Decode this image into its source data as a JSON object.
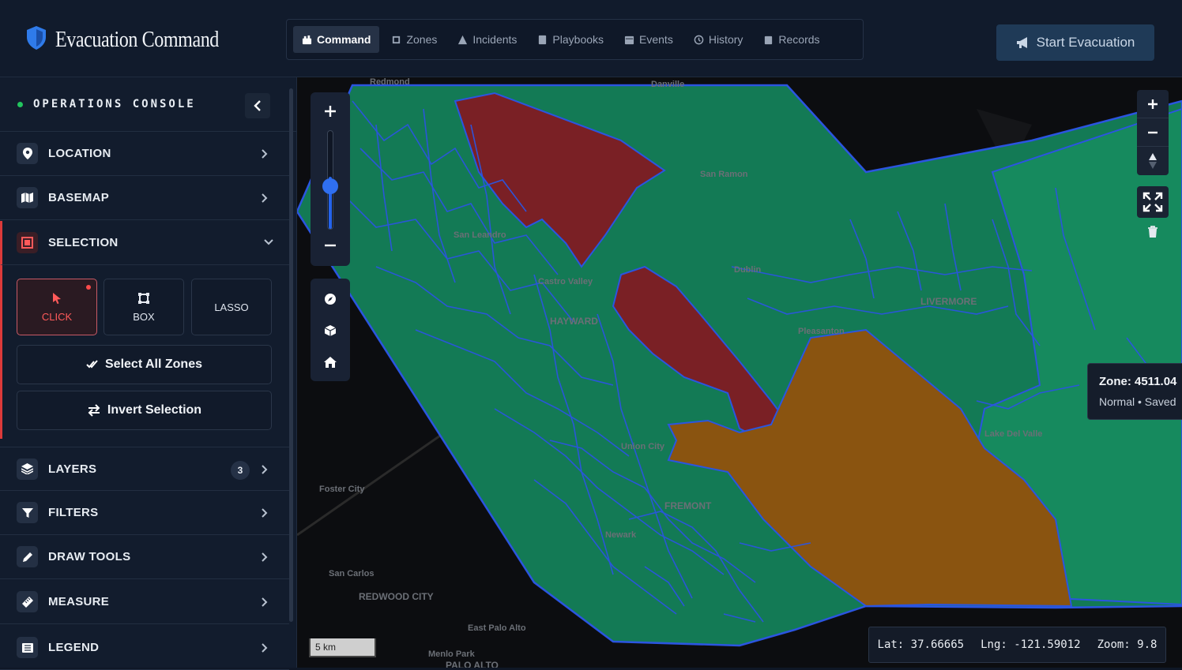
{
  "app": {
    "title": "Evacuation Command",
    "start_button": "Start Evacuation"
  },
  "nav": {
    "tabs": [
      {
        "label": "Command",
        "icon": "command-icon",
        "active": true
      },
      {
        "label": "Zones",
        "icon": "zones-icon",
        "active": false
      },
      {
        "label": "Incidents",
        "icon": "warning-icon",
        "active": false
      },
      {
        "label": "Playbooks",
        "icon": "book-icon",
        "active": false
      },
      {
        "label": "Events",
        "icon": "calendar-icon",
        "active": false
      },
      {
        "label": "History",
        "icon": "history-icon",
        "active": false
      },
      {
        "label": "Records",
        "icon": "clipboard-icon",
        "active": false
      }
    ]
  },
  "sidebar": {
    "title": "OPERATIONS CONSOLE",
    "sections": {
      "location": "LOCATION",
      "basemap": "BASEMAP",
      "selection": "SELECTION",
      "layers": "LAYERS",
      "layers_count": "3",
      "filters": "FILTERS",
      "draw_tools": "DRAW TOOLS",
      "measure": "MEASURE",
      "legend": "LEGEND"
    },
    "selection": {
      "modes": {
        "click": "CLICK",
        "box": "BOX",
        "lasso": "LASSO"
      },
      "active_mode": "click",
      "select_all": "Select All Zones",
      "invert": "Invert Selection"
    }
  },
  "map": {
    "tooltip": {
      "zone": "Zone: 4511.04",
      "status": "Normal • Saved"
    },
    "scale": "5 km",
    "coords": {
      "lat": "Lat: 37.66665",
      "lng": "Lng: -121.59012",
      "zoom": "Zoom: 9.8"
    },
    "zoom_slider_level": 0.47,
    "places": [
      "Danville",
      "San Ramon",
      "Dublin",
      "LIVERMORE",
      "Pleasanton",
      "HAYWARD",
      "Castro Valley",
      "San Leandro",
      "Union City",
      "FREMONT",
      "Newark",
      "Foster City",
      "San Carlos",
      "REDWOOD CITY",
      "East Palo Alto",
      "Menlo Park",
      "PALO ALTO",
      "Lake Del Valle",
      "Redmond"
    ],
    "colors": {
      "normal": "#137a55",
      "high_risk": "#7a2025",
      "warning": "#8a5410",
      "boundary": "#2b55e0"
    }
  }
}
